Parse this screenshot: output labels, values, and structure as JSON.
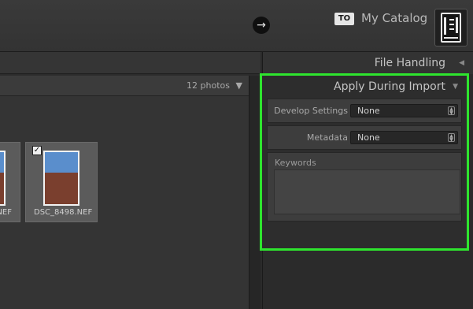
{
  "topbar": {
    "arrow_icon": "→",
    "to_badge": "TO",
    "catalog_name": "My Catalog"
  },
  "grid": {
    "photo_count": "12 photos",
    "count_icon": "▼",
    "photos": [
      {
        "filename": "NEF"
      },
      {
        "filename": "DSC_8498.NEF",
        "checked": true
      }
    ]
  },
  "panel": {
    "file_handling_title": "File Handling",
    "file_handling_icon": "◀",
    "apply_title": "Apply During Import",
    "apply_icon": "▼",
    "develop_label": "Develop Settings",
    "develop_value": "None",
    "metadata_label": "Metadata",
    "metadata_value": "None",
    "keywords_label": "Keywords",
    "keywords_value": ""
  },
  "colors": {
    "highlight": "#2ee52e",
    "background": "#2b2b2b"
  }
}
